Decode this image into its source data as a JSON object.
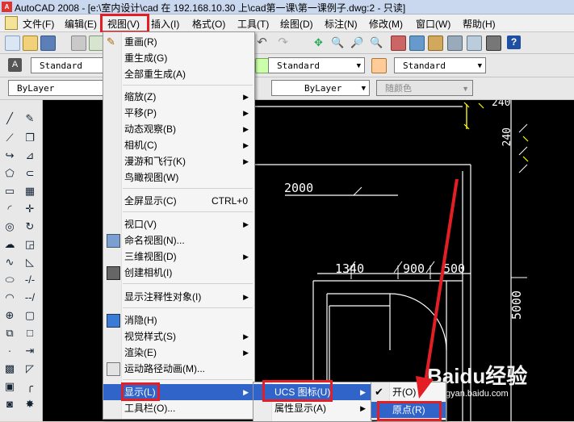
{
  "window": {
    "title": "AutoCAD 2008 - [e:\\室内设计\\cad 在 192.168.10.30 上\\cad第一课\\第一课例子.dwg:2 - 只读]",
    "app_icon_text": "A"
  },
  "menubar": {
    "items": [
      "文件(F)",
      "编辑(E)",
      "视图(V)",
      "插入(I)",
      "格式(O)",
      "工具(T)",
      "绘图(D)",
      "标注(N)",
      "修改(M)",
      "窗口(W)",
      "帮助(H)"
    ]
  },
  "toolbar2": {
    "text_style": "Standard",
    "dim_style": "Standard",
    "table_style": "Standard"
  },
  "toolbar3": {
    "layer": "ByLayer",
    "linetype": "ByLayer",
    "color": "随颜色"
  },
  "view_menu": {
    "items": [
      {
        "label": "重画(R)"
      },
      {
        "label": "重生成(G)"
      },
      {
        "label": "全部重生成(A)"
      },
      {
        "label": "缩放(Z)"
      },
      {
        "label": "平移(P)"
      },
      {
        "label": "动态观察(B)"
      },
      {
        "label": "相机(C)"
      },
      {
        "label": "漫游和飞行(K)"
      },
      {
        "label": "鸟瞰视图(W)"
      },
      {
        "label": "全屏显示(C)",
        "shortcut": "CTRL+0"
      },
      {
        "label": "视口(V)"
      },
      {
        "label": "命名视图(N)..."
      },
      {
        "label": "三维视图(D)"
      },
      {
        "label": "创建相机(I)"
      },
      {
        "label": "显示注释性对象(I)"
      },
      {
        "label": "消隐(H)"
      },
      {
        "label": "视觉样式(S)"
      },
      {
        "label": "渲染(E)"
      },
      {
        "label": "运动路径动画(M)..."
      },
      {
        "label": "显示(L)"
      },
      {
        "label": "工具栏(O)..."
      }
    ]
  },
  "display_submenu": {
    "items": [
      {
        "label": "UCS 图标(U)"
      },
      {
        "label": "属性显示(A)"
      }
    ]
  },
  "ucs_submenu": {
    "items": [
      {
        "label": "开(O)",
        "checked": true
      },
      {
        "label": "原点(R)"
      }
    ]
  },
  "drawing": {
    "dims": [
      "2000",
      "1340",
      "900",
      "500",
      "240",
      "240",
      "5000"
    ]
  },
  "watermark": {
    "text": "Baidu经验",
    "sub": "jingyan.baidu.com"
  },
  "colors": {
    "highlight": "#3164c8",
    "annotation": "#e31e24",
    "canvas": "#000000"
  }
}
